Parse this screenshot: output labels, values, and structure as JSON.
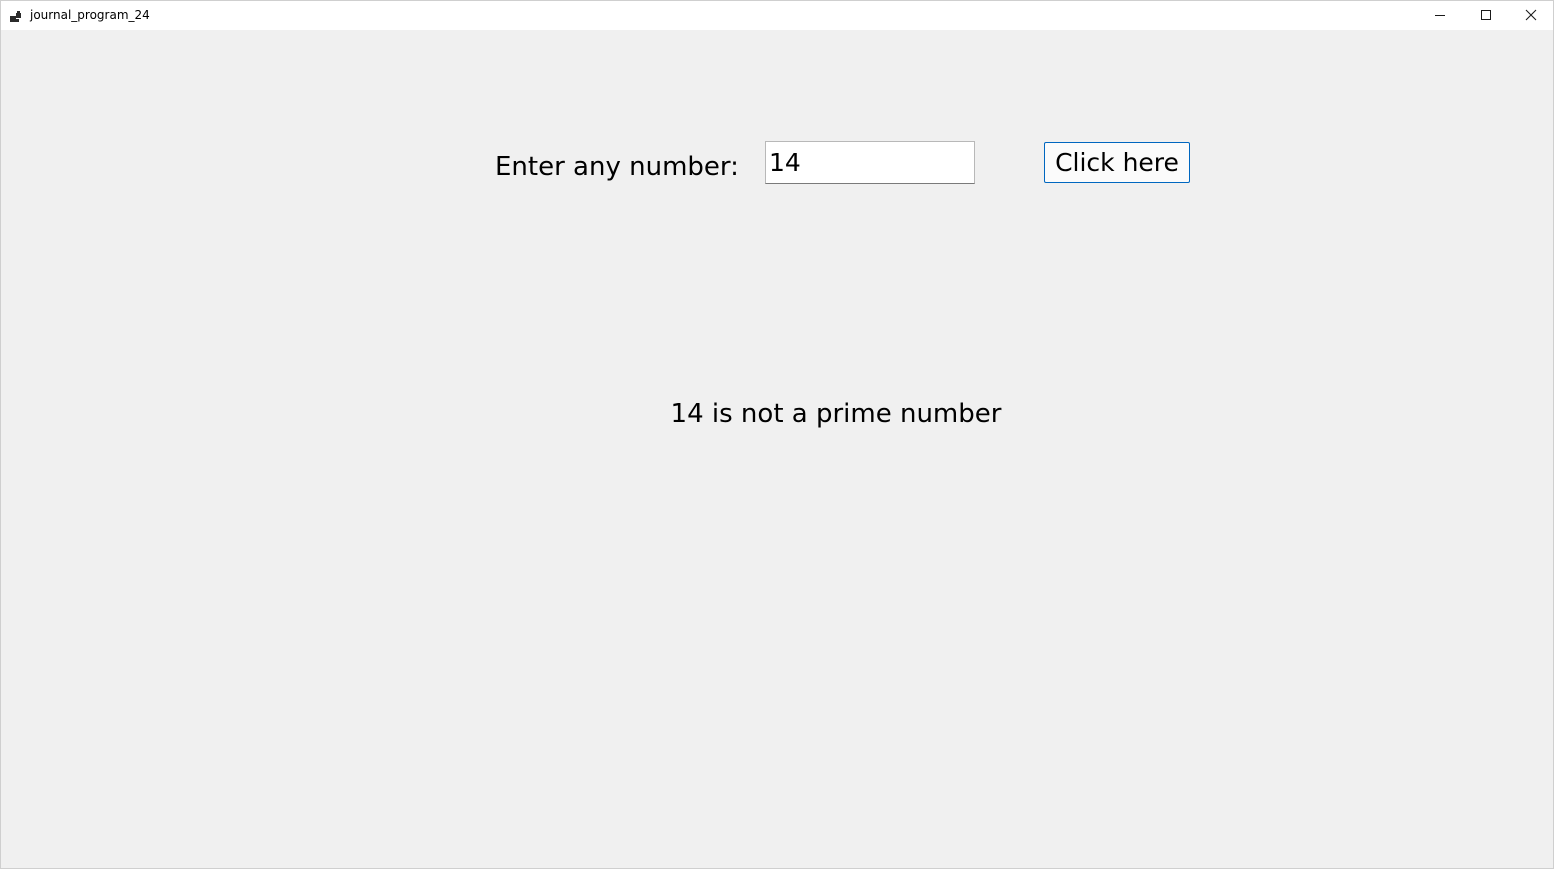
{
  "window": {
    "title": "journal_program_24",
    "app_icon": "app-window-icon",
    "controls": {
      "minimize_icon": "minimize-icon",
      "maximize_icon": "maximize-icon",
      "close_icon": "close-icon"
    }
  },
  "form": {
    "prompt_label": "Enter any number:",
    "input_value": "14",
    "button_label": "Click here",
    "accent_color": "#0067c0"
  },
  "result": {
    "message": "14 is not a prime number"
  }
}
